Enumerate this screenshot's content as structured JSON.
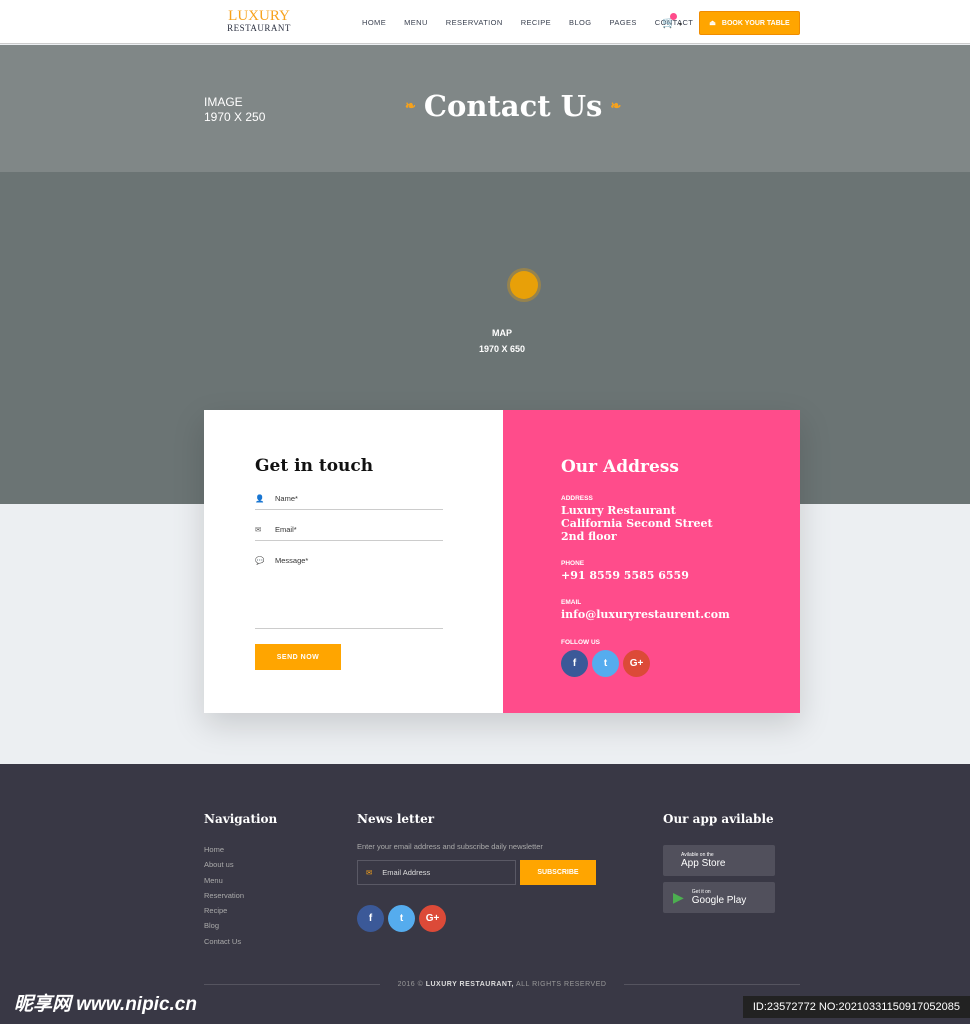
{
  "header": {
    "logo_top": "LUXURY",
    "logo_bottom": "RESTAURANT",
    "nav": [
      "HOME",
      "MENU",
      "RESERVATION",
      "RECIPE",
      "BLOG",
      "PAGES",
      "CONTACT"
    ],
    "cart_badge": "0",
    "book_label": "BOOK YOUR TABLE"
  },
  "banner": {
    "placeholder_line1": "IMAGE",
    "placeholder_line2": "1970 X 250",
    "title": "Contact Us"
  },
  "map": {
    "line1": "MAP",
    "line2": "1970 X 650"
  },
  "form": {
    "title": "Get in touch",
    "name_placeholder": "Name*",
    "email_placeholder": "Email*",
    "message_placeholder": "Message*",
    "send_label": "SEND NOW"
  },
  "address": {
    "title": "Our Address",
    "address_label": "ADDRESS",
    "address_lines": [
      "Luxury Restaurant",
      "California Second Street",
      "2nd floor"
    ],
    "phone_label": "PHONE",
    "phone": "+91 8559 5585 6559",
    "email_label": "EMAIL",
    "email": "info@luxuryrestaurent.com",
    "follow_label": "FOLLOW US"
  },
  "footer": {
    "nav_title": "Navigation",
    "nav_items": [
      "Home",
      "About us",
      "Menu",
      "Reservation",
      "Recipe",
      "Blog",
      "Contact Us"
    ],
    "newsletter_title": "News letter",
    "newsletter_desc": "Enter your email address and subscribe daily newsletter",
    "email_placeholder": "Email Address",
    "subscribe_label": "SUBSCRIBE",
    "app_title": "Our app avilable",
    "appstore_small": "Avilable on the",
    "appstore_big": "App Store",
    "play_small": "Get it on",
    "play_big": "Google Play",
    "copyright_year": "2016 ©",
    "copyright_brand": "LUXURY RESTAURANT,",
    "copyright_rest": "ALL RIGHTS RESERVED"
  },
  "watermark": {
    "left": "昵享网 www.nipic.cn",
    "right": "ID:23572772 NO:20210331150917052085"
  },
  "colors": {
    "accent": "#ffa500",
    "pink": "#ff4c8b",
    "footer": "#393845",
    "facebook": "#3b5998",
    "twitter": "#55acee",
    "google": "#dc4a38"
  }
}
